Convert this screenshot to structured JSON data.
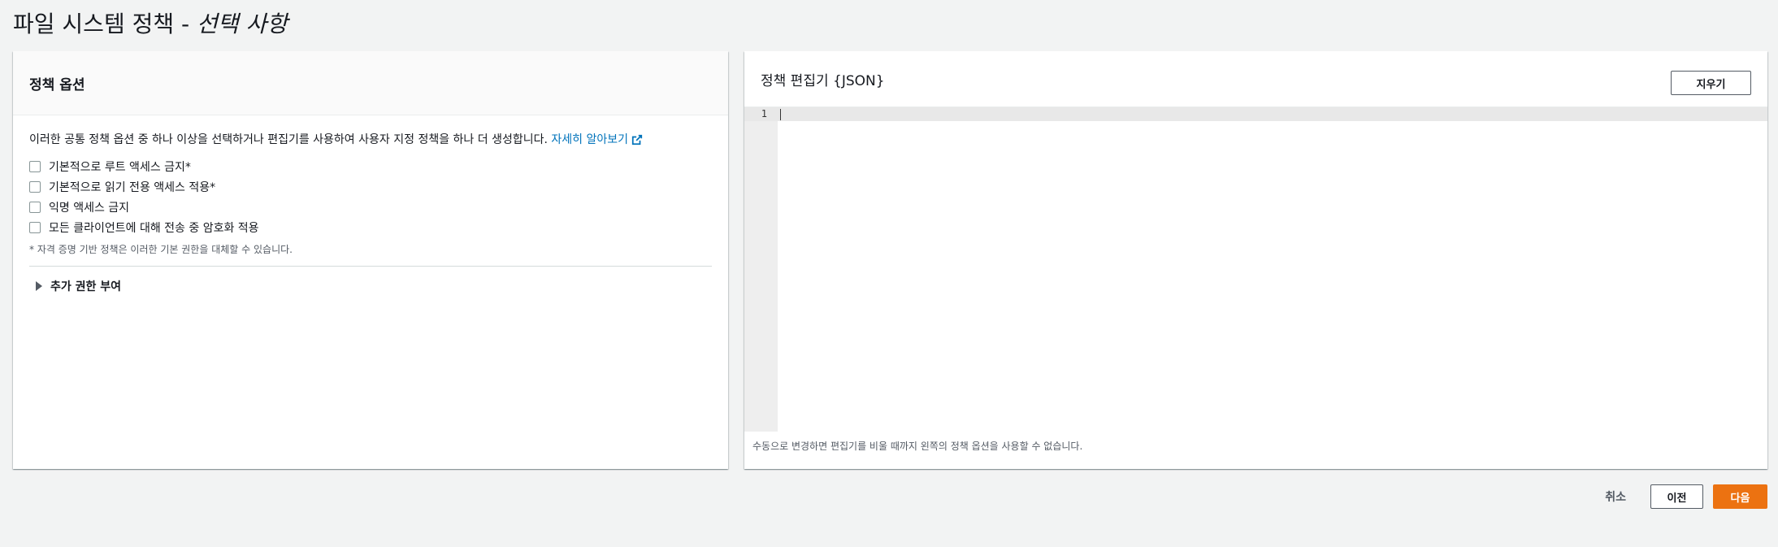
{
  "page": {
    "title_main": "파일 시스템 정책 - ",
    "title_optional": "선택 사항"
  },
  "policy_options": {
    "header": "정책 옵션",
    "intro": "이러한 공통 정책 옵션 중 하나 이상을 선택하거나 편집기를 사용하여 사용자 지정 정책을 하나 더 생성합니다. ",
    "learn_more": "자세히 알아보기",
    "options": [
      {
        "label": "기본적으로 루트 액세스 금지*",
        "checked": false
      },
      {
        "label": "기본적으로 읽기 전용 액세스 적용*",
        "checked": false
      },
      {
        "label": "익명 액세스 금지",
        "checked": false
      },
      {
        "label": "모든 클라이언트에 대해 전송 중 암호화 적용",
        "checked": false
      }
    ],
    "footnote": "* 자격 증명 기반 정책은 이러한 기본 권한을 대체할 수 있습니다.",
    "expander": "추가 권한 부여"
  },
  "editor": {
    "header": "정책 편집기 {JSON}",
    "clear_label": "지우기",
    "line_numbers": [
      "1"
    ],
    "note": "수동으로 변경하면 편집기를 비울 때까지 왼쪽의 정책 옵션을 사용할 수 없습니다."
  },
  "actions": {
    "cancel": "취소",
    "previous": "이전",
    "next": "다음"
  },
  "colors": {
    "primary": "#ec7211",
    "link": "#0073bb",
    "background": "#f2f3f3"
  }
}
